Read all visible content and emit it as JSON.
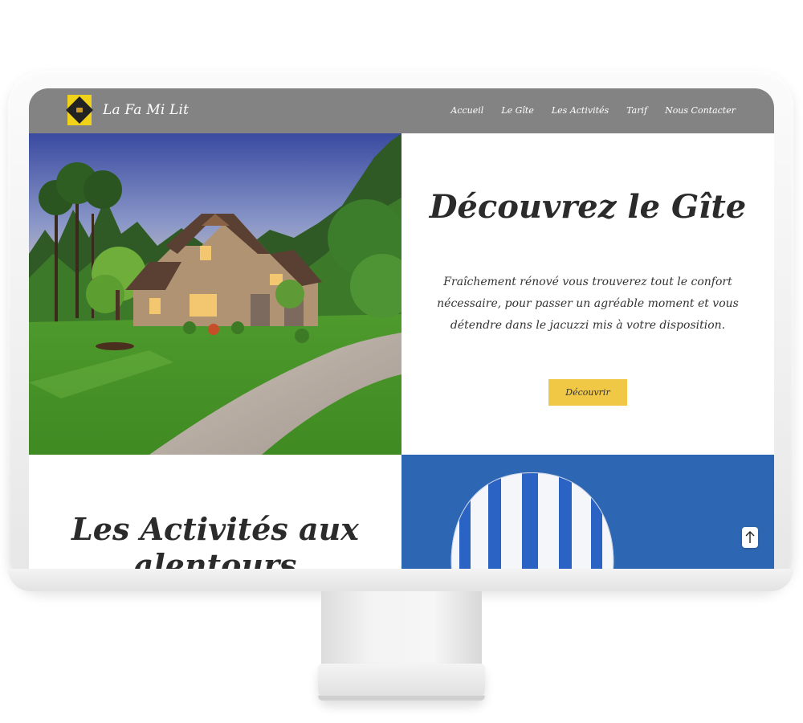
{
  "nav": {
    "brand": "La Fa Mi Lit",
    "links": [
      "Accueil",
      "Le Gîte",
      "Les Activités",
      "Tarif",
      "Nous Contacter"
    ]
  },
  "hero": {
    "title": "Découvrez le Gîte",
    "description": "Fraîchement rénové vous trouverez tout le confort nécessaire, pour passer un agréable moment et vous détendre dans le jacuzzi mis à votre disposition.",
    "button_label": "Découvrir"
  },
  "activities": {
    "title": "Les Activités aux alentours"
  },
  "icons": {
    "scroll_top": "arrow-up-icon"
  },
  "colors": {
    "nav_bg": "#838383",
    "button_bg": "#f0c846",
    "balloon_sky": "#2d67b3",
    "logo_yellow": "#f0d21a"
  }
}
